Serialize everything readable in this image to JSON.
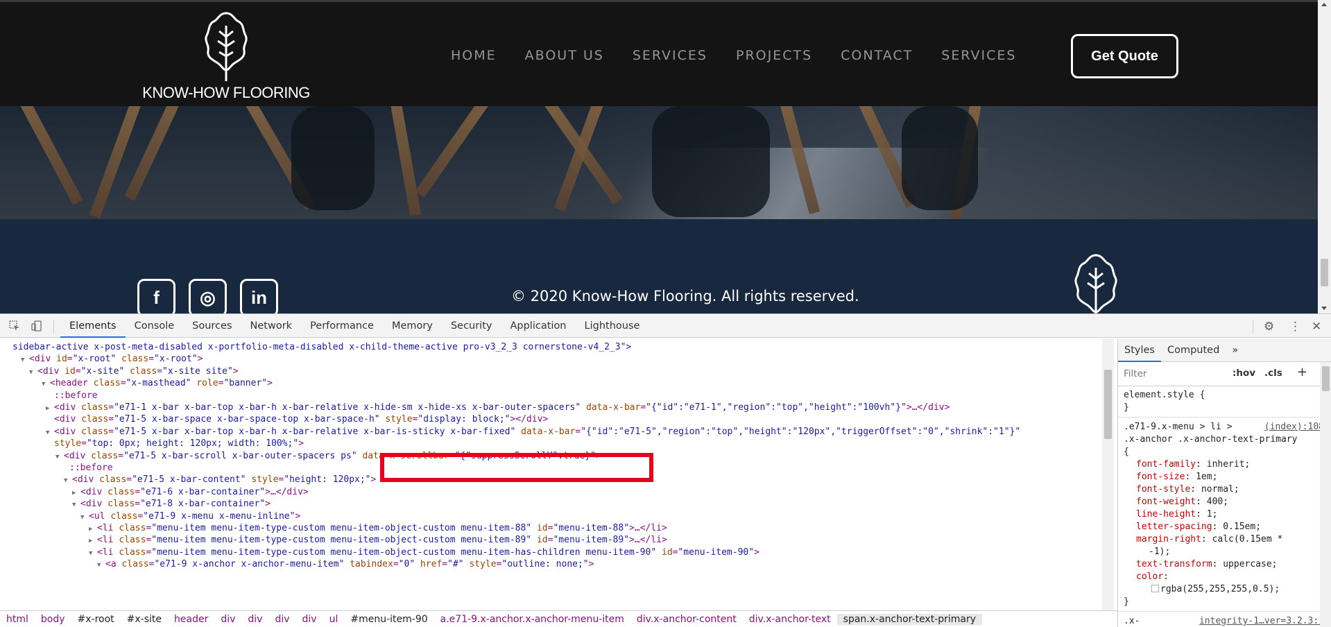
{
  "site": {
    "logo_text": "KNOW-HOW FLOORING",
    "nav": [
      "HOME",
      "ABOUT US",
      "SERVICES",
      "PROJECTS",
      "CONTACT",
      "SERVICES"
    ],
    "cta": "Get Quote",
    "social": [
      {
        "icon": "facebook-icon",
        "glyph": "f"
      },
      {
        "icon": "instagram-icon",
        "glyph": "◎"
      },
      {
        "icon": "linkedin-icon",
        "glyph": "in"
      }
    ],
    "copyright": "© 2020 Know-How Flooring. All rights reserved."
  },
  "devtools": {
    "tabs": [
      "Elements",
      "Console",
      "Sources",
      "Network",
      "Performance",
      "Memory",
      "Security",
      "Application",
      "Lighthouse"
    ],
    "active_tab": "Elements",
    "side_tabs": [
      "Styles",
      "Computed"
    ],
    "filter_placeholder": "Filter",
    "hov": ":hov",
    "cls": ".cls",
    "plus": "+",
    "styles": {
      "element_style": "element.style {",
      "close": "}",
      "rule_selector_1": ".e71-9.x-menu > li >",
      "rule_source": "(index):108",
      "rule_selector_2": ".x-anchor .x-anchor-text-primary",
      "open": "{",
      "props": [
        {
          "name": "font-family",
          "value": "inherit;"
        },
        {
          "name": "font-size",
          "value": "1em;"
        },
        {
          "name": "font-style",
          "value": "normal;"
        },
        {
          "name": "font-weight",
          "value": "400;"
        },
        {
          "name": "line-height",
          "value": "1;"
        },
        {
          "name": "letter-spacing",
          "value": "0.15em;"
        },
        {
          "name": "margin-right",
          "value": "calc(0.15em *"
        },
        {
          "name": "",
          "value": "-1);"
        },
        {
          "name": "text-transform",
          "value": "uppercase;"
        },
        {
          "name": "color",
          "value": ""
        },
        {
          "name": "",
          "value": "rgba(255,255,255,0.5);"
        }
      ],
      "bottom_selector": ".x-",
      "bottom_source": "integrity-1…ver=3.2.3:1"
    },
    "breadcrumbs": [
      "html",
      "body",
      "#x-root",
      "#x-site",
      "header",
      "div",
      "div",
      "div",
      "div",
      "ul",
      "#menu-item-90",
      "a.e71-9.x-anchor.x-anchor-menu-item",
      "div.x-anchor-content",
      "div.x-anchor-text",
      "span.x-anchor-text-primary"
    ],
    "code": [
      {
        "tri": "",
        "html": "sidebar-active x-post-meta-disabled x-portfolio-meta-disabled x-child-theme-active pro-v3_2_3 cornerstone-v4_2_3\">"
      },
      {
        "tri": "▼",
        "tag": "div",
        "attrs": [
          [
            "id",
            "x-root"
          ],
          [
            "class",
            "x-root"
          ]
        ]
      },
      {
        "tri": "▼",
        "tag": "div",
        "attrs": [
          [
            "id",
            "x-site"
          ],
          [
            "class",
            "x-site site"
          ]
        ]
      },
      {
        "tri": "▼",
        "tag": "header",
        "attrs": [
          [
            "class",
            "x-masthead"
          ],
          [
            "role",
            "banner"
          ]
        ]
      },
      {
        "pseudo": "::before"
      },
      {
        "tri": "▶",
        "tag": "div",
        "attrs": [
          [
            "class",
            "e71-1 x-bar x-bar-top x-bar-h x-bar-relative  x-hide-sm x-hide-xs x-bar-outer-spacers"
          ],
          [
            "data-x-bar",
            "{\"id\":\"e71-1\",\"region\":\"top\",\"height\":\"100vh\"}"
          ]
        ],
        "tail": "…</div>"
      },
      {
        "tri": "",
        "tag": "div",
        "attrs": [
          [
            "class",
            "e71-5 x-bar-space x-bar-space-top x-bar-space-h"
          ],
          [
            "style",
            "display: block;"
          ]
        ],
        "tail": "</div>"
      },
      {
        "tri": "▼",
        "tag": "div",
        "attrs": [
          [
            "class",
            "e71-5 x-bar x-bar-top x-bar-h x-bar-relative x-bar-is-sticky x-bar-fixed"
          ],
          [
            "data-x-bar",
            "{\"id\":\"e71-5\",\"region\":\"top\",\"height\":\"120px\",\"triggerOffset\":\"0\",\"shrink\":\"1\"}"
          ]
        ],
        "cont": true
      },
      {
        "cont_text": "style=\"top: 0px; height: 120px; width: 100%;\">"
      },
      {
        "tri": "▼",
        "tag": "div",
        "attrs": [
          [
            "class",
            "e71-5 x-bar-scroll x-bar-outer-spacers ps"
          ],
          [
            "data-x-scrollbar",
            "{\"suppressScrollY\":true}"
          ]
        ]
      },
      {
        "pseudo": "::before"
      },
      {
        "tri": "▼",
        "tag": "div",
        "attrs": [
          [
            "class",
            "e71-5 x-bar-content"
          ],
          [
            "style",
            "height: 120px;"
          ]
        ]
      },
      {
        "tri": "▶",
        "tag": "div",
        "attrs": [
          [
            "class",
            "e71-6 x-bar-container"
          ]
        ],
        "tail": "…</div>"
      },
      {
        "tri": "▼",
        "tag": "div",
        "attrs": [
          [
            "class",
            "e71-8 x-bar-container"
          ]
        ]
      },
      {
        "tri": "▼",
        "tag": "ul",
        "attrs": [
          [
            "class",
            "e71-9 x-menu x-menu-inline"
          ]
        ]
      },
      {
        "tri": "▶",
        "tag": "li",
        "attrs": [
          [
            "class",
            "menu-item menu-item-type-custom menu-item-object-custom menu-item-88"
          ],
          [
            "id",
            "menu-item-88"
          ]
        ],
        "tail": "…</li>"
      },
      {
        "tri": "▶",
        "tag": "li",
        "attrs": [
          [
            "class",
            "menu-item menu-item-type-custom menu-item-object-custom menu-item-89"
          ],
          [
            "id",
            "menu-item-89"
          ]
        ],
        "tail": "…</li>"
      },
      {
        "tri": "▼",
        "tag": "li",
        "attrs": [
          [
            "class",
            "menu-item menu-item-type-custom menu-item-object-custom menu-item-has-children menu-item-90"
          ],
          [
            "id",
            "menu-item-90"
          ]
        ]
      },
      {
        "tri": "▼",
        "tag": "a",
        "attrs": [
          [
            "class",
            "e71-9 x-anchor x-anchor-menu-item"
          ],
          [
            "tabindex",
            "0"
          ],
          [
            "href",
            "#"
          ],
          [
            "style",
            "outline: none;"
          ]
        ]
      }
    ]
  }
}
